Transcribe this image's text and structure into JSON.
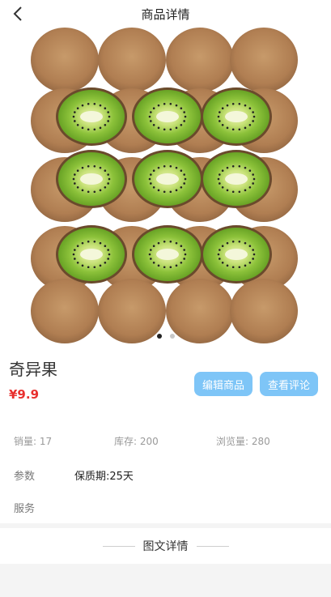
{
  "header": {
    "title": "商品详情",
    "back_icon": "chevron-left-icon"
  },
  "gallery": {
    "image_alt": "kiwi fruit",
    "slide_count": 2,
    "active_slide": 1
  },
  "product": {
    "name": "奇异果",
    "price": "¥9.9",
    "price_color": "#e8302e"
  },
  "actions": {
    "edit_label": "编辑商品",
    "review_label": "查看评论",
    "button_color": "#7ec5f7"
  },
  "stats": {
    "sales": "销量: 17",
    "stock": "库存: 200",
    "views": "浏览量: 280"
  },
  "params": {
    "label": "参数",
    "value": "保质期:25天"
  },
  "service": {
    "label": "服务"
  },
  "detail_section": {
    "title": "图文详情"
  }
}
